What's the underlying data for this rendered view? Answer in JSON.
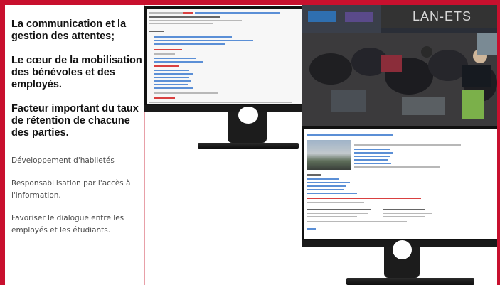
{
  "left_panel": {
    "headings": [
      "La communication et la gestion des attentes;",
      "Le cœur de la mobilisation des bénévoles et des employés.",
      "Facteur important du taux de rétention de chacune des parties."
    ],
    "points": [
      "Développement d'habiletés",
      "Responsabilisation par l'accès à l'information.",
      "Favoriser le dialogue entre les employés et les étudiants."
    ]
  },
  "photo": {
    "banner_text": "LAN-ETS"
  },
  "colors": {
    "accent": "#c8102e",
    "link": "#5b8fd6"
  }
}
